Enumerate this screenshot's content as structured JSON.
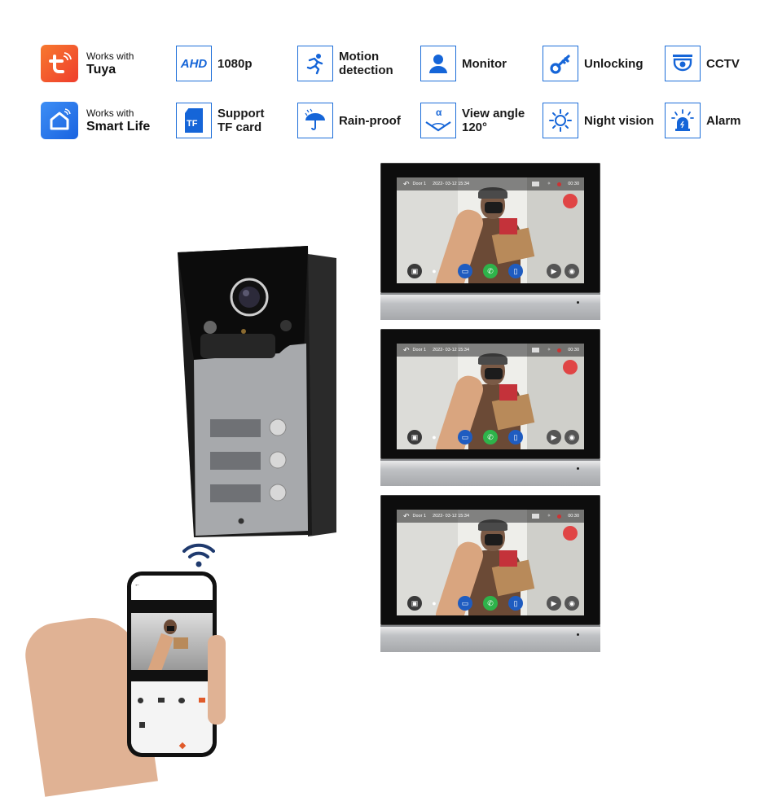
{
  "features": [
    {
      "id": "tuya",
      "line1": "Works with",
      "line2": "Tuya",
      "icon": "tuya-logo-icon",
      "color": "#f2552c"
    },
    {
      "id": "smartlife",
      "line1": "Works with",
      "line2": "Smart Life",
      "icon": "smart-life-logo-icon",
      "color": "#2b7ff0"
    },
    {
      "id": "ahd",
      "icon_text": "AHD",
      "line1": "1080p",
      "icon": "ahd-icon"
    },
    {
      "id": "tf",
      "icon_text": "TF",
      "line1": "Support",
      "line2": "TF card",
      "icon": "sd-card-icon"
    },
    {
      "id": "motion",
      "line1": "Motion",
      "line2": "detection",
      "icon": "running-person-icon"
    },
    {
      "id": "rain",
      "line1": "Rain-proof",
      "icon": "umbrella-icon"
    },
    {
      "id": "monitor",
      "line1": "Monitor",
      "icon": "person-icon"
    },
    {
      "id": "angle",
      "icon_text": "α",
      "line1": "View angle",
      "line2": "120°",
      "icon": "view-angle-icon"
    },
    {
      "id": "unlock",
      "line1": "Unlocking",
      "icon": "key-icon"
    },
    {
      "id": "night",
      "line1": "Night vision",
      "icon": "sun-icon"
    },
    {
      "id": "cctv",
      "line1": "CCTV",
      "icon": "dome-camera-icon"
    },
    {
      "id": "alarm",
      "line1": "Alarm",
      "icon": "siren-icon"
    }
  ],
  "accent_color": "#1565d8",
  "monitor_screen": {
    "door_label": "Door 1",
    "datetime": "2022- 03-12 15:34",
    "timer": "00:30"
  },
  "monitor_count": 3
}
